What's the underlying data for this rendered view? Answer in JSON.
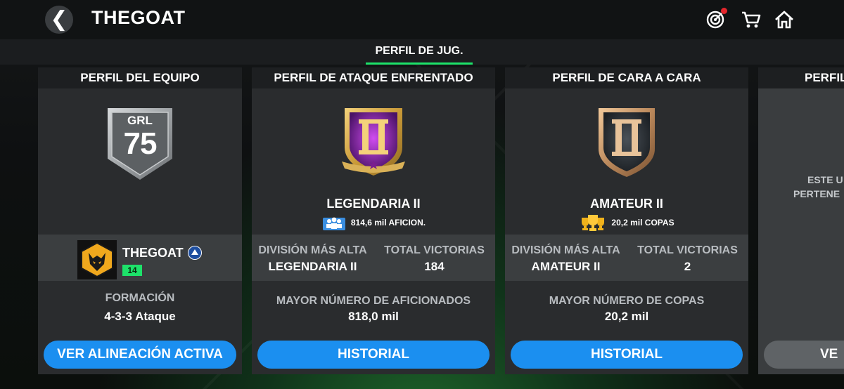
{
  "header": {
    "back_glyph": "❮",
    "title": "THEGOAT",
    "icons": [
      "objectives-target-icon",
      "store-cart-icon",
      "home-icon"
    ],
    "notification_color": "#e4262c"
  },
  "tabs": {
    "active_label": "PERFIL DE JUG.",
    "accent": "#1de26a"
  },
  "team_card": {
    "title": "PERFIL DEL EQUIPO",
    "grl_label": "GRL",
    "grl_value": "75",
    "club_name": "THEGOAT",
    "level": "14",
    "formation_label": "FORMACIÓN",
    "formation_value": "4-3-3 Ataque",
    "button_label": "VER ALINEACIÓN ACTIVA"
  },
  "attack_card": {
    "title": "PERFIL DE ATAQUE ENFRENTADO",
    "rank": "LEGENDARIA II",
    "stat": "814,6 mil AFICION.",
    "col1_label": "DIVISIÓN MÁS ALTA",
    "col1_value": "LEGENDARIA II",
    "col2_label": "TOTAL VICTORIAS",
    "col2_value": "184",
    "record_label": "MAYOR NÚMERO DE AFICIONADOS",
    "record_value": "818,0 mil",
    "button_label": "HISTORIAL"
  },
  "h2h_card": {
    "title": "PERFIL DE CARA A CARA",
    "rank": "AMATEUR II",
    "stat": "20,2 mil COPAS",
    "col1_label": "DIVISIÓN MÁS ALTA",
    "col1_value": "AMATEUR II",
    "col2_label": "TOTAL VICTORIAS",
    "col2_value": "2",
    "record_label": "MAYOR NÚMERO DE COPAS",
    "record_value": "20,2 mil",
    "button_label": "HISTORIAL"
  },
  "partial_card": {
    "title": "PERFIL",
    "line1": "ESTE U",
    "line2": "PERTENE",
    "button_label": "VE"
  },
  "colors": {
    "button_blue": "#1b8ff0",
    "button_disabled": "#5f6366",
    "level_badge": "#1de26a"
  }
}
